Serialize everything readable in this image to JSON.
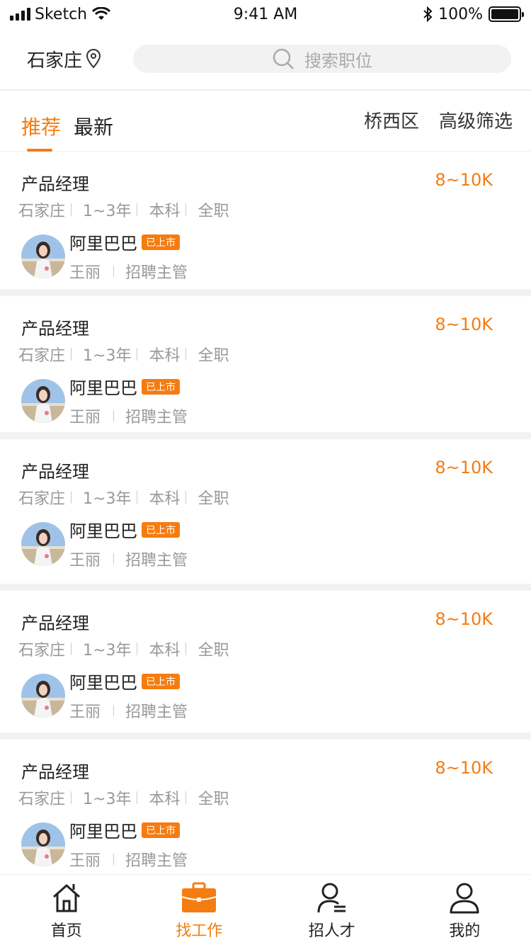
{
  "status_bar": {
    "carrier": "Sketch",
    "time": "9:41 AM",
    "battery": "100%"
  },
  "header": {
    "city": "石家庄",
    "search_placeholder": "搜索职位"
  },
  "tabs": [
    {
      "label": "推荐",
      "active": true
    },
    {
      "label": "最新",
      "active": false
    }
  ],
  "filters": {
    "district": "桥西区",
    "advanced": "高级筛选"
  },
  "jobs": [
    {
      "title": "产品经理",
      "salary": "8~10K",
      "city": "石家庄",
      "experience": "1~3年",
      "education": "本科",
      "type": "全职",
      "company": "阿里巴巴",
      "badge": "已上市",
      "recruiter": "王丽",
      "role": "招聘主管"
    },
    {
      "title": "产品经理",
      "salary": "8~10K",
      "city": "石家庄",
      "experience": "1~3年",
      "education": "本科",
      "type": "全职",
      "company": "阿里巴巴",
      "badge": "已上市",
      "recruiter": "王丽",
      "role": "招聘主管"
    },
    {
      "title": "产品经理",
      "salary": "8~10K",
      "city": "石家庄",
      "experience": "1~3年",
      "education": "本科",
      "type": "全职",
      "company": "阿里巴巴",
      "badge": "已上市",
      "recruiter": "王丽",
      "role": "招聘主管"
    },
    {
      "title": "产品经理",
      "salary": "8~10K",
      "city": "石家庄",
      "experience": "1~3年",
      "education": "本科",
      "type": "全职",
      "company": "阿里巴巴",
      "badge": "已上市",
      "recruiter": "王丽",
      "role": "招聘主管"
    },
    {
      "title": "产品经理",
      "salary": "8~10K",
      "city": "石家庄",
      "experience": "1~3年",
      "education": "本科",
      "type": "全职",
      "company": "阿里巴巴",
      "badge": "已上市",
      "recruiter": "王丽",
      "role": "招聘主管"
    }
  ],
  "bottom_nav": [
    {
      "label": "首页",
      "icon": "home-icon",
      "active": false
    },
    {
      "label": "找工作",
      "icon": "briefcase-icon",
      "active": true
    },
    {
      "label": "招人才",
      "icon": "recruit-icon",
      "active": false
    },
    {
      "label": "我的",
      "icon": "profile-icon",
      "active": false
    }
  ],
  "colors": {
    "accent": "#f57c11",
    "divider": "#f2f2f2"
  }
}
